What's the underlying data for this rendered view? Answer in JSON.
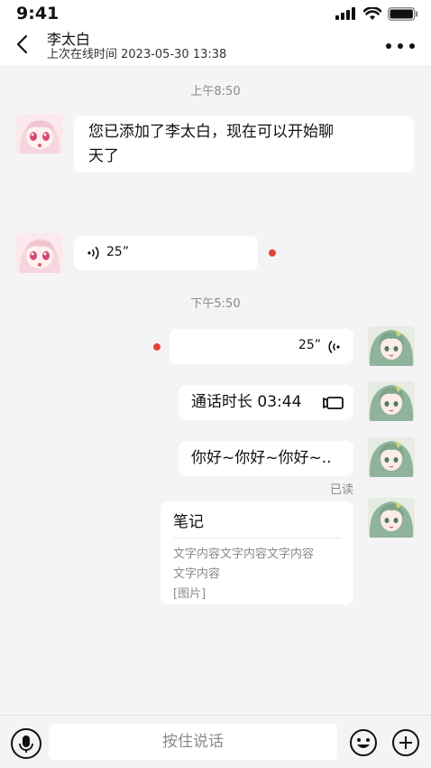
{
  "status_bar": {
    "time": "9:41",
    "icons": [
      "signal-icon",
      "wifi-icon",
      "battery-icon"
    ]
  },
  "header": {
    "contact_name": "李太白",
    "last_online": "上次在线时间 2023-05-30 13:38"
  },
  "messages": {
    "timestamp_1": "上午8:50",
    "system_added": "您已添加了李太白，现在可以开始聊天了",
    "system_added_line1": "您已添加了李太白，现在可以开始聊",
    "system_added_line2": "天了",
    "voice_in_duration": "25”",
    "timestamp_2": "下午5:50",
    "voice_out_duration": "25”",
    "call_duration": "通话时长 03:44",
    "greeting": "你好~你好~你好~..",
    "read_status": "已读",
    "note": {
      "title": "笔记",
      "content_line1": "文字内容文字内容文字内容",
      "content_line2": "文字内容",
      "content_line3": "[图片]"
    }
  },
  "bottom_bar": {
    "hold_to_talk": "按住说话",
    "icons": [
      "microphone-icon",
      "emoji-icon",
      "plus-icon"
    ]
  },
  "colors": {
    "background": "#f4f4f6",
    "bubble": "#ffffff",
    "unread_dot": "#e8413c",
    "muted_text": "#8a8a8a"
  }
}
